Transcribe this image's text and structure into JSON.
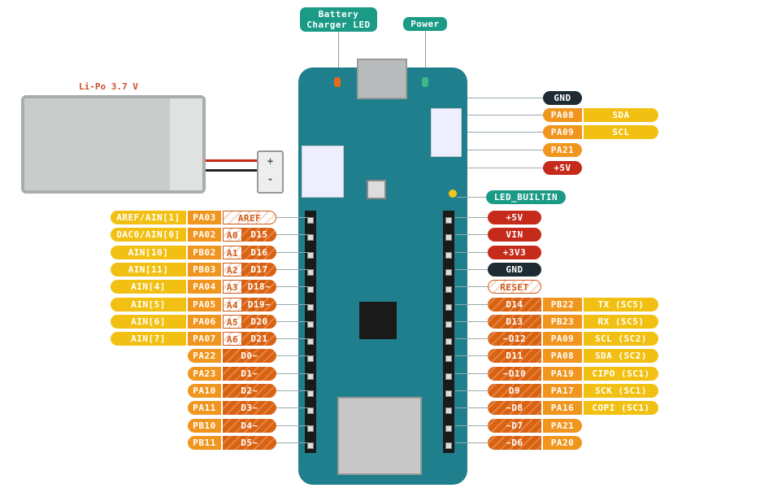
{
  "callouts": {
    "battery_charger_led": "Battery\nCharger LED",
    "power": "Power",
    "led_builtin": "LED_BUILTIN"
  },
  "battery": {
    "label": "Li-Po 3.7 V",
    "plus": "+",
    "minus": "-"
  },
  "colors": {
    "analog": "#f1c012",
    "port": "#f0961e",
    "digital": "#d9620f",
    "power": "#c52a1a",
    "ground": "#1e2b33",
    "led": "#1b9a86",
    "board": "#1f7f8d"
  },
  "left_pins": [
    {
      "func": "AREF/AIN[1]",
      "port": "PA03",
      "a": "",
      "d": "AREF"
    },
    {
      "func": "DAC0/AIN[0]",
      "port": "PA02",
      "a": "A0",
      "d": "D15"
    },
    {
      "func": "AIN[10]",
      "port": "PB02",
      "a": "A1",
      "d": "D16"
    },
    {
      "func": "AIN[11]",
      "port": "PB03",
      "a": "A2",
      "d": "D17"
    },
    {
      "func": "AIN[4]",
      "port": "PA04",
      "a": "A3",
      "d": "D18~"
    },
    {
      "func": "AIN[5]",
      "port": "PA05",
      "a": "A4",
      "d": "D19~"
    },
    {
      "func": "AIN[6]",
      "port": "PA06",
      "a": "A5",
      "d": "D20"
    },
    {
      "func": "AIN[7]",
      "port": "PA07",
      "a": "A6",
      "d": "D21"
    },
    {
      "func": "",
      "port": "PA22",
      "a": "",
      "d": "D0~"
    },
    {
      "func": "",
      "port": "PA23",
      "a": "",
      "d": "D1~"
    },
    {
      "func": "",
      "port": "PA10",
      "a": "",
      "d": "D2~"
    },
    {
      "func": "",
      "port": "PA11",
      "a": "",
      "d": "D3~"
    },
    {
      "func": "",
      "port": "PB10",
      "a": "",
      "d": "D4~"
    },
    {
      "func": "",
      "port": "PB11",
      "a": "",
      "d": "D5~"
    }
  ],
  "right_pins": [
    {
      "kind": "power",
      "d": "+5V"
    },
    {
      "kind": "power",
      "d": "VIN"
    },
    {
      "kind": "power",
      "d": "+3V3"
    },
    {
      "kind": "ground",
      "d": "GND"
    },
    {
      "kind": "reset",
      "d": "RESET"
    },
    {
      "kind": "digital",
      "d": "D14",
      "port": "PB22",
      "func": "TX (SC5)"
    },
    {
      "kind": "digital",
      "d": "D13",
      "port": "PB23",
      "func": "RX (SC5)"
    },
    {
      "kind": "digital",
      "d": "~D12",
      "port": "PA09",
      "func": "SCL (SC2)"
    },
    {
      "kind": "digital",
      "d": "D11",
      "port": "PA08",
      "func": "SDA (SC2)"
    },
    {
      "kind": "digital",
      "d": "~D10",
      "port": "PA19",
      "func": "CIPO (SC1)"
    },
    {
      "kind": "digital",
      "d": "D9",
      "port": "PA17",
      "func": "SCK (SC1)"
    },
    {
      "kind": "digital",
      "d": "~D8",
      "port": "PA16",
      "func": "COPI (SC1)"
    },
    {
      "kind": "digital",
      "d": "~D7",
      "port": "PA21",
      "func": ""
    },
    {
      "kind": "digital",
      "d": "~D6",
      "port": "PA20",
      "func": ""
    }
  ],
  "eslov": [
    {
      "kind": "ground",
      "port": "GND",
      "func": ""
    },
    {
      "kind": "port",
      "port": "PA08",
      "func": "SDA"
    },
    {
      "kind": "port",
      "port": "PA09",
      "func": "SCL"
    },
    {
      "kind": "port",
      "port": "PA21",
      "func": ""
    },
    {
      "kind": "power",
      "port": "+5V",
      "func": ""
    }
  ]
}
